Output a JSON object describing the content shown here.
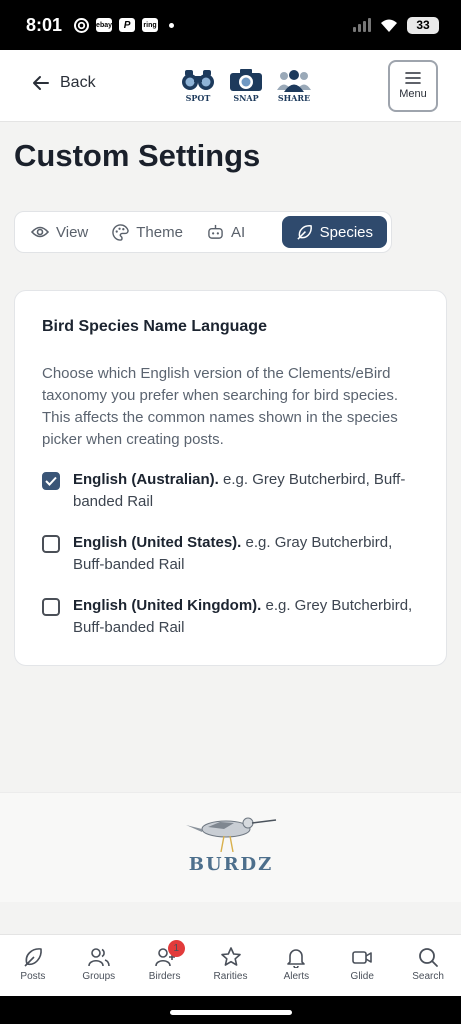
{
  "status": {
    "time": "8:01",
    "battery": "33",
    "apps": [
      "chrome-icon",
      "ebay",
      "P",
      "ring"
    ]
  },
  "header": {
    "back_label": "Back",
    "brand": [
      {
        "label": "SPOT",
        "icon": "binoculars-icon"
      },
      {
        "label": "SNAP",
        "icon": "camera-icon"
      },
      {
        "label": "SHARE",
        "icon": "people-icon"
      }
    ],
    "menu_label": "Menu"
  },
  "page": {
    "title": "Custom Settings"
  },
  "tabs": [
    {
      "label": "View",
      "icon": "eye-icon",
      "active": false
    },
    {
      "label": "Theme",
      "icon": "palette-icon",
      "active": false
    },
    {
      "label": "AI",
      "icon": "robot-icon",
      "active": false
    },
    {
      "label": "Species",
      "icon": "feather-icon",
      "active": true
    }
  ],
  "card": {
    "title": "Bird Species Name Language",
    "description": "Choose which English version of the Clements/eBird taxonomy you prefer when searching for bird species. This affects the common names shown in the species picker when creating posts.",
    "options": [
      {
        "name": "English (Australian).",
        "example": " e.g. Grey Butcherbird, Buff-banded Rail",
        "checked": true
      },
      {
        "name": "English (United States).",
        "example": " e.g. Gray Butcherbird, Buff-banded Rail",
        "checked": false
      },
      {
        "name": "English (United Kingdom).",
        "example": " e.g. Grey Butcherbird, Buff-banded Rail",
        "checked": false
      }
    ]
  },
  "footer": {
    "logo_text": "BURDZ"
  },
  "nav": [
    {
      "label": "Posts",
      "icon": "feather-icon"
    },
    {
      "label": "Groups",
      "icon": "groups-icon"
    },
    {
      "label": "Birders",
      "icon": "add-user-icon",
      "badge": "1"
    },
    {
      "label": "Rarities",
      "icon": "star-icon"
    },
    {
      "label": "Alerts",
      "icon": "bell-icon"
    },
    {
      "label": "Glide",
      "icon": "video-icon"
    },
    {
      "label": "Search",
      "icon": "search-icon"
    }
  ],
  "colors": {
    "accent": "#2f4a6d",
    "checkbox": "#3a5577",
    "badge": "#e23b3b",
    "logo": "#4d6f8c"
  }
}
